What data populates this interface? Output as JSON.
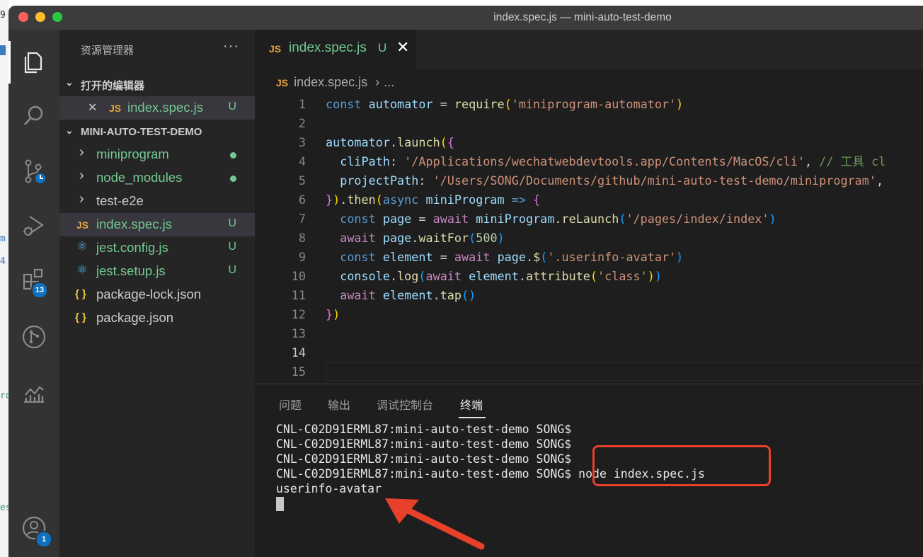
{
  "window": {
    "title": "index.spec.js — mini-auto-test-demo",
    "traffic_lights": [
      "#ff5f57",
      "#febc2e",
      "#28c840"
    ]
  },
  "activity_bar": {
    "items": [
      {
        "icon": "files-icon"
      },
      {
        "icon": "search-icon"
      },
      {
        "icon": "source-control-icon"
      },
      {
        "icon": "run-debug-icon"
      },
      {
        "icon": "extensions-icon",
        "badge": "13"
      },
      {
        "icon": "git-graph-icon"
      },
      {
        "icon": "timeline-chart-icon"
      }
    ],
    "account_badge": "1"
  },
  "explorer": {
    "header": "资源管理器",
    "more": "···",
    "open_editors_title": "打开的编辑器",
    "open_editors": [
      {
        "close": "✕",
        "icon": "JS",
        "name": "index.spec.js",
        "status": "U"
      }
    ],
    "project_title": "MINI-AUTO-TEST-DEMO",
    "tree": [
      {
        "type": "folder",
        "chevron": "›",
        "name": "miniprogram",
        "dot": true
      },
      {
        "type": "folder",
        "chevron": "›",
        "name": "node_modules",
        "dot": true
      },
      {
        "type": "folder",
        "chevron": "›",
        "name": "test-e2e"
      },
      {
        "type": "js",
        "icon": "JS",
        "name": "index.spec.js",
        "status": "U",
        "selected": true
      },
      {
        "type": "react",
        "icon": "⚛",
        "name": "jest.config.js",
        "status": "U"
      },
      {
        "type": "react",
        "icon": "⚛",
        "name": "jest.setup.js",
        "status": "U"
      },
      {
        "type": "json",
        "icon": "{ }",
        "name": "package-lock.json"
      },
      {
        "type": "json",
        "icon": "{ }",
        "name": "package.json"
      }
    ]
  },
  "editor": {
    "tab": {
      "icon": "JS",
      "name": "index.spec.js",
      "status": "U",
      "close": "✕"
    },
    "breadcrumb": {
      "icon": "JS",
      "file": "index.spec.js",
      "sep": "›",
      "tail": "..."
    },
    "current_line": 14,
    "lines": [
      {
        "n": "1",
        "text": "const automator = require('miniprogram-automator')"
      },
      {
        "n": "2",
        "text": ""
      },
      {
        "n": "3",
        "text": "automator.launch({"
      },
      {
        "n": "4",
        "text": "  cliPath: '/Applications/wechatwebdevtools.app/Contents/MacOS/cli', // 工具 cl"
      },
      {
        "n": "5",
        "text": "  projectPath: '/Users/SONG/Documents/github/mini-auto-test-demo/miniprogram',"
      },
      {
        "n": "6",
        "text": "}).then(async miniProgram => {"
      },
      {
        "n": "7",
        "text": "  const page = await miniProgram.reLaunch('/pages/index/index')"
      },
      {
        "n": "8",
        "text": "  await page.waitFor(500)"
      },
      {
        "n": "9",
        "text": "  const element = await page.$('.userinfo-avatar')"
      },
      {
        "n": "10",
        "text": "  console.log(await element.attribute('class'))"
      },
      {
        "n": "11",
        "text": "  await element.tap()"
      },
      {
        "n": "12",
        "text": "})"
      },
      {
        "n": "13",
        "text": ""
      },
      {
        "n": "14",
        "text": ""
      },
      {
        "n": "15",
        "text": ""
      }
    ]
  },
  "panel": {
    "tabs": [
      "问题",
      "输出",
      "调试控制台",
      "终端"
    ],
    "active_tab": "终端",
    "terminal": [
      "CNL-C02D91ERML87:mini-auto-test-demo SONG$",
      "CNL-C02D91ERML87:mini-auto-test-demo SONG$",
      "CNL-C02D91ERML87:mini-auto-test-demo SONG$",
      "CNL-C02D91ERML87:mini-auto-test-demo SONG$ node index.spec.js",
      "userinfo-avatar"
    ]
  },
  "left_edge_fragments": [
    "9",
    "m",
    "4",
    "ro",
    "es"
  ],
  "colors": {
    "untracked": "#73c991",
    "js_icon": "#e8a33e",
    "annotation_red": "#e8402a",
    "badge_blue": "#0e70c0"
  }
}
